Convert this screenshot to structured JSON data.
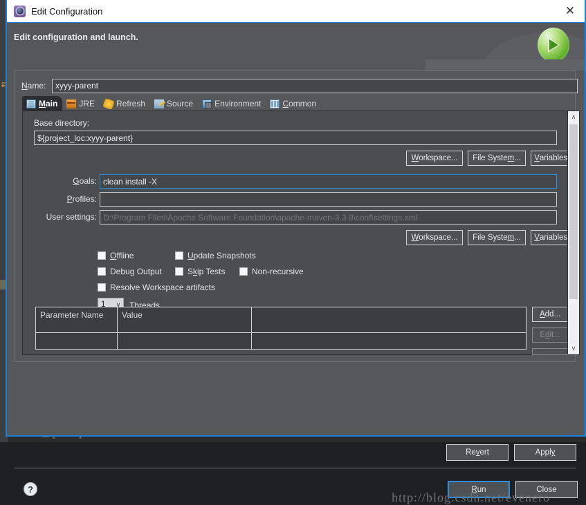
{
  "window": {
    "title": "Edit Configuration",
    "app_icon": "eclipse-launch-icon",
    "close_label": "✕",
    "header_message": "Edit configuration and launch.",
    "run_badge_icon": "green-run-play-icon"
  },
  "name_field": {
    "label_pre": "N",
    "label_accel": "N",
    "label": "Name:",
    "value": "xyyy-parent"
  },
  "tabs": [
    {
      "label": "Main",
      "accel": "M",
      "icon": "main-tab-icon",
      "active": true
    },
    {
      "label": "JRE",
      "accel": "J",
      "icon": "jre-tab-icon",
      "active": false
    },
    {
      "label": "Refresh",
      "accel": "e",
      "icon": "refresh-tab-icon",
      "active": false
    },
    {
      "label": "Source",
      "accel": "S",
      "icon": "source-tab-icon",
      "active": false
    },
    {
      "label": "Environment",
      "accel": "E",
      "icon": "environment-tab-icon",
      "active": false
    },
    {
      "label": "Common",
      "accel": "C",
      "icon": "common-tab-icon",
      "active": false
    }
  ],
  "main_tab": {
    "base_directory": {
      "label": "Base directory:",
      "value": "${project_loc:xyyy-parent}"
    },
    "base_dir_buttons": [
      {
        "label": "Workspace...",
        "name": "workspace-button-basedir"
      },
      {
        "label": "File System...",
        "name": "file-system-button-basedir"
      },
      {
        "label": "Variables...",
        "name": "variables-button-basedir"
      }
    ],
    "goals": {
      "label": "Goals:",
      "value": "clean install -X",
      "focused": true
    },
    "profiles": {
      "label": "Profiles:",
      "value": ""
    },
    "user_settings": {
      "label": "User settings:",
      "placeholder": "D:\\Program Files\\Apache Software Foundation\\apache-maven-3.3.9\\conf\\settings.xml",
      "value": ""
    },
    "user_settings_buttons": [
      {
        "label": "Workspace...",
        "name": "workspace-button-settings"
      },
      {
        "label": "File System...",
        "name": "file-system-button-settings"
      },
      {
        "label": "Variables...",
        "name": "variables-button-settings"
      }
    ],
    "checkboxes": [
      {
        "label": "Offline",
        "checked": false,
        "name": "checkbox-offline"
      },
      {
        "label": "Update Snapshots",
        "checked": false,
        "name": "checkbox-update-snapshots"
      },
      {
        "label": "Debug Output",
        "checked": false,
        "name": "checkbox-debug-output"
      },
      {
        "label": "Skip Tests",
        "checked": false,
        "name": "checkbox-skip-tests"
      },
      {
        "label": "Non-recursive",
        "checked": false,
        "name": "checkbox-non-recursive"
      },
      {
        "label": "Resolve Workspace artifacts",
        "checked": false,
        "name": "checkbox-resolve-workspace-artifacts"
      }
    ],
    "threads": {
      "value": "1",
      "label": "Threads",
      "arrow": "∨"
    },
    "parameters_table": {
      "columns": [
        "Parameter Name",
        "Value",
        ""
      ],
      "rows": [
        [
          "",
          "",
          ""
        ]
      ]
    },
    "table_buttons": [
      {
        "label": "Add...",
        "disabled": false,
        "name": "add-parameter-button"
      },
      {
        "label": "Edit...",
        "disabled": true,
        "name": "edit-parameter-button"
      }
    ]
  },
  "scrollbar": {
    "up_arrow": "∧",
    "down_arrow": "∨"
  },
  "footer": {
    "revert_label": "Revert",
    "apply_label": "Apply",
    "run_label": "Run",
    "close_label": "Close",
    "help_icon": "?"
  },
  "watermark": "http://blog.csdn.net/evenero",
  "background": {
    "console_text": "[INFO] ------------------------------------------------------------------------"
  },
  "colors": {
    "dialog_border": "#1e7fd6",
    "dialog_bg": "#555759",
    "panel_bg": "#4b4e51",
    "field_bg": "#44474a",
    "accent_focus": "#2e8fe0",
    "text": "#e6e6e6",
    "run_green": "#53a81f"
  }
}
